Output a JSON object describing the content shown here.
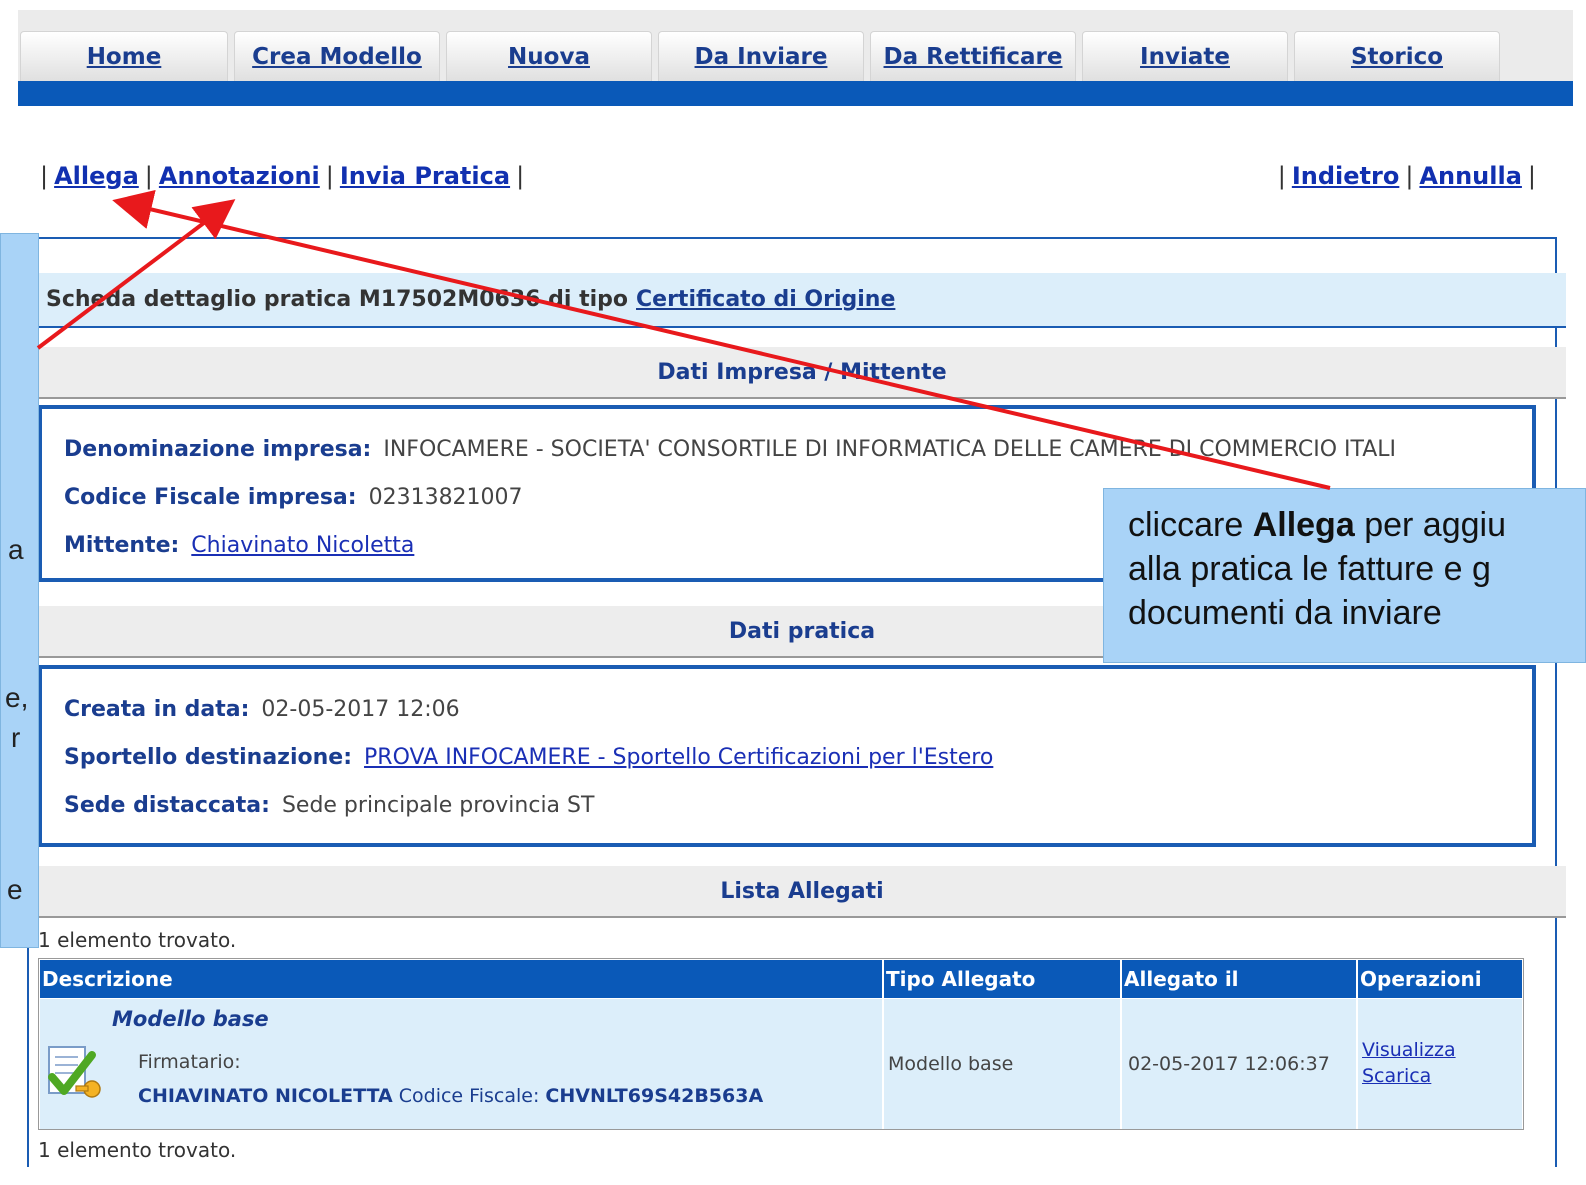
{
  "nav": {
    "tabs": [
      {
        "label": "Home"
      },
      {
        "label": "Crea Modello"
      },
      {
        "label": "Nuova"
      },
      {
        "label": "Da Inviare"
      },
      {
        "label": "Da Rettificare"
      },
      {
        "label": "Inviate"
      },
      {
        "label": "Storico"
      }
    ]
  },
  "actions": {
    "left": [
      "Allega",
      "Annotazioni",
      "Invia Pratica"
    ],
    "right": [
      "Indietro",
      "Annulla"
    ]
  },
  "scheda": {
    "prefix": "Scheda dettaglio pratica M17502M0636 di tipo",
    "type_link": "Certificato di Origine"
  },
  "impresa": {
    "header": "Dati Impresa / Mittente",
    "denominazione_label": "Denominazione impresa:",
    "denominazione_value": "INFOCAMERE - SOCIETA' CONSORTILE DI INFORMATICA DELLE CAMERE DI COMMERCIO ITALI",
    "cf_label": "Codice Fiscale impresa:",
    "cf_value": "02313821007",
    "mittente_label": "Mittente:",
    "mittente_value": "Chiavinato Nicoletta"
  },
  "pratica": {
    "header": "Dati pratica",
    "creata_label": "Creata in data:",
    "creata_value": "02-05-2017 12:06",
    "sportello_label": "Sportello destinazione:",
    "sportello_value": "PROVA INFOCAMERE - Sportello Certificazioni per l'Estero",
    "sede_label": "Sede distaccata:",
    "sede_value": "Sede principale provincia ST"
  },
  "allegati": {
    "header": "Lista Allegati",
    "found_text": "1 elemento trovato.",
    "columns": [
      "Descrizione",
      "Tipo Allegato",
      "Allegato il",
      "Operazioni"
    ],
    "row": {
      "title": "Modello base",
      "firmatario_label": "Firmatario:",
      "firmatario_name": "CHIAVINATO NICOLETTA",
      "cf_label": "Codice Fiscale:",
      "cf_value": "CHVNLT69S42B563A",
      "tipo": "Modello base",
      "data": "02-05-2017 12:06:37",
      "op_view": "Visualizza",
      "op_download": "Scarica"
    }
  },
  "callout_right": {
    "line1_pre": "cliccare",
    "line1_bold": "Allega",
    "line1_post": "per aggiu",
    "line2": "alla pratica le fatture e g",
    "line3": "documenti da inviare"
  },
  "callout_left": {
    "fragments": [
      "a",
      "e,",
      "r",
      "e"
    ]
  },
  "colors": {
    "nav_bar": "#0a59b8",
    "link": "#1a3d8f",
    "callout": "#a9d3f7",
    "arrow": "#e8191c"
  }
}
